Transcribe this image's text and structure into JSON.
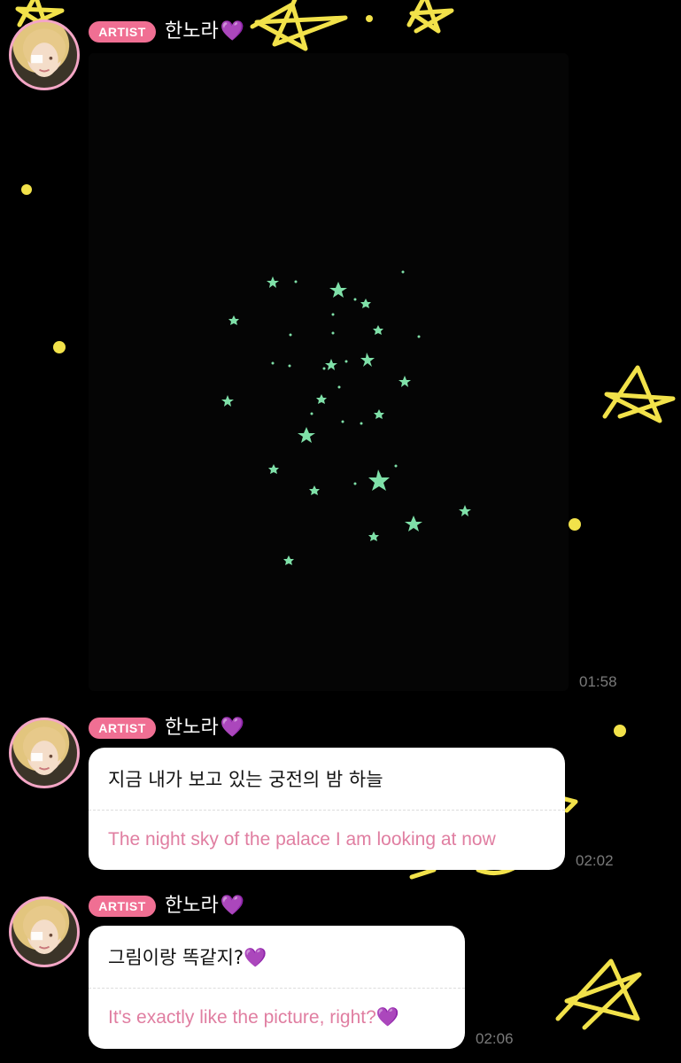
{
  "colors": {
    "badge_bg": "#f06f93",
    "translation_text": "#e07ea1",
    "heart": "#9b3bdc",
    "star_yellow": "#f2e24a",
    "star_green": "#7fe0a8"
  },
  "messages": [
    {
      "badge": "ARTIST",
      "sender": "한노라",
      "sender_heart": "💜",
      "type": "image",
      "image_description_icon": "night-sky-stars-image",
      "time": "01:58"
    },
    {
      "badge": "ARTIST",
      "sender": "한노라",
      "sender_heart": "💜",
      "type": "text",
      "original": "지금 내가 보고 있는 궁전의 밤 하늘",
      "translation": "The night sky of the palace I am looking at now",
      "time": "02:02"
    },
    {
      "badge": "ARTIST",
      "sender": "한노라",
      "sender_heart": "💜",
      "type": "text",
      "original": "그림이랑 똑같지?💜",
      "translation": "It's exactly like the picture, right?💜",
      "time": "02:06"
    }
  ]
}
